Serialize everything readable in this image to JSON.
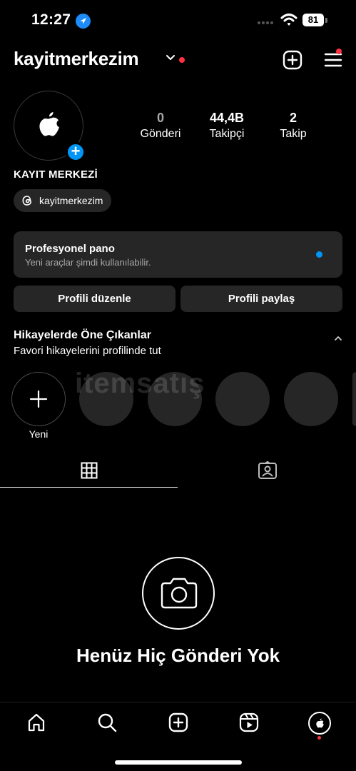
{
  "status_bar": {
    "time": "12:27",
    "battery": "81",
    "icons": [
      "location-arrow-icon",
      "signal-icon",
      "wifi-icon",
      "battery-icon"
    ]
  },
  "header": {
    "username": "kayitmerkezim",
    "icons": [
      "chevron-down-icon",
      "new-post-icon",
      "menu-icon"
    ],
    "notification_color": "#ff3040"
  },
  "profile": {
    "stats": [
      {
        "value": "0",
        "label": "Gönderi"
      },
      {
        "value": "44,4B",
        "label": "Takipçi"
      },
      {
        "value": "2",
        "label": "Takip"
      }
    ],
    "display_name": "KAYIT MERKEZİ",
    "threads_handle": "kayitmerkezim"
  },
  "professional_dashboard": {
    "title": "Profesyonel pano",
    "subtitle": "Yeni araçlar şimdi kullanılabilir.",
    "dot_color": "#0095f6"
  },
  "actions": {
    "edit_label": "Profili düzenle",
    "share_label": "Profili paylaş"
  },
  "highlights": {
    "title": "Hikayelerde Öne Çıkanlar",
    "subtitle": "Favori hikayelerini profilinde tut",
    "new_label": "Yeni"
  },
  "watermark": "itemsatış",
  "tabs": [
    "grid-icon",
    "tagged-icon"
  ],
  "empty_state": {
    "title": "Henüz Hiç Gönderi Yok",
    "icon": "camera-icon"
  },
  "bottom_nav": [
    "home-icon",
    "search-icon",
    "create-icon",
    "reels-icon",
    "profile-avatar"
  ],
  "colors": {
    "background": "#000000",
    "surface": "#262626",
    "accent": "#0095f6",
    "alert": "#ff3040"
  }
}
